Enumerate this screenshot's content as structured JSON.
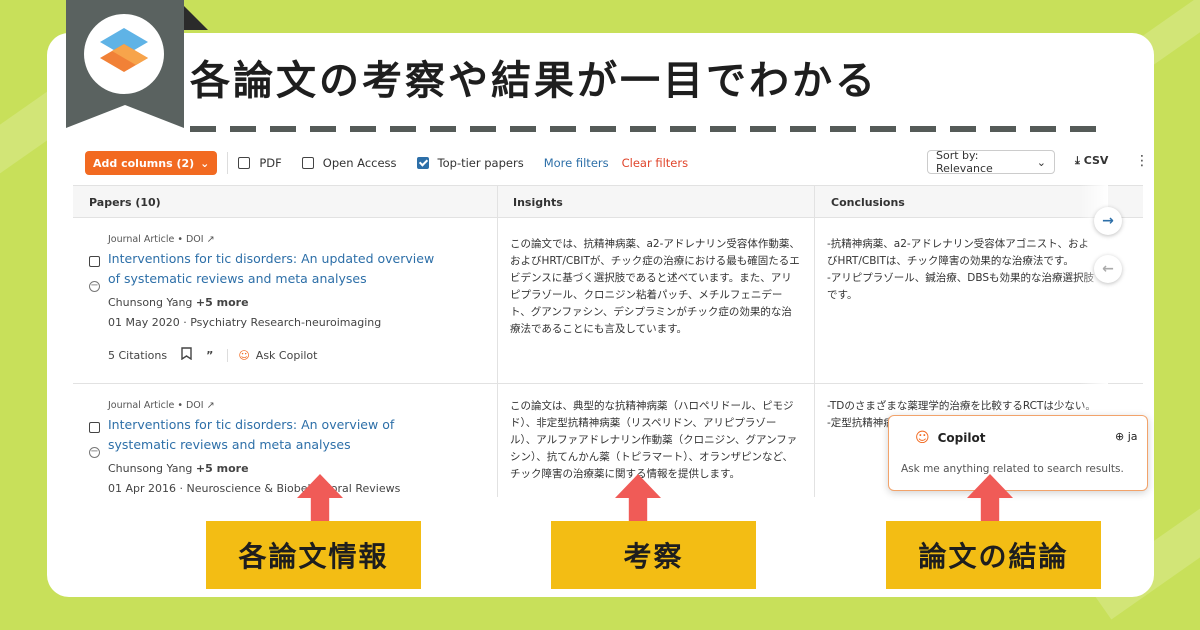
{
  "headline": "各論文の考察や結果が一目でわかる",
  "toolbar": {
    "add_columns": "Add columns (2)",
    "pdf": "PDF",
    "open_access": "Open Access",
    "top_tier": "Top-tier papers",
    "more_filters": "More filters",
    "clear_filters": "Clear filters",
    "sort": "Sort by: Relevance",
    "csv": "CSV"
  },
  "table": {
    "col_papers": "Papers (10)",
    "col_insights": "Insights",
    "col_conclusions": "Conclusions",
    "rows": [
      {
        "meta": "Journal Article • DOI",
        "title": "Interventions for tic disorders: An updated overview of systematic reviews and meta analyses",
        "author": "Chunsong Yang",
        "more": "+5 more",
        "date": "01 May 2020 · Psychiatry Research-neuroimaging",
        "citations": "5 Citations",
        "ask": "Ask Copilot",
        "insight": "この論文では、抗精神病薬、a2-アドレナリン受容体作動薬、およびHRT/CBITが、チック症の治療における最も確固たるエビデンスに基づく選択肢であると述べています。また、アリピプラゾール、クロニジン粘着パッチ、メチルフェニデート、グアンファシン、デシプラミンがチック症の効果的な治療法であることにも言及しています。",
        "conclusion": "-抗精神病薬、a2-アドレナリン受容体アゴニスト、およびHRT/CBITは、チック障害の効果的な治療法です。\n-アリピプラゾール、鍼治療、DBSも効果的な治療選択肢です。"
      },
      {
        "meta": "Journal Article • DOI",
        "title": "Interventions for tic disorders: An overview of systematic reviews and meta analyses",
        "author": "Chunsong Yang",
        "more": "+5 more",
        "date": "01 Apr 2016 · Neuroscience & Biobehavioral Reviews",
        "insight": "この論文は、典型的な抗精神病薬（ハロペリドール、ピモジド）、非定型抗精神病薬（リスペリドン、アリピプラゾール）、アルファアドレナリン作動薬（クロニジン、グアンファシン）、抗てんかん薬（トピラマート）、オランザピンなど、チック障害の治療薬に関する情報を提供します。",
        "conclusion": "-TDのさまざまな薬理学的治療を比較するRCTは少ない。\n-定型抗精神病薬... と見なされ..."
      }
    ]
  },
  "copilot": {
    "title": "Copilot",
    "lang": "ja",
    "hint": "Ask me anything related to search results."
  },
  "labels": {
    "papers": "各論文情報",
    "insights": "考察",
    "conclusions": "論文の結論"
  },
  "colors": {
    "background": "#c8e05a",
    "accent_orange": "#f26a21",
    "link_blue": "#2d6fa8",
    "arrow_red": "#f05b57",
    "label_yellow": "#f3bd14"
  }
}
